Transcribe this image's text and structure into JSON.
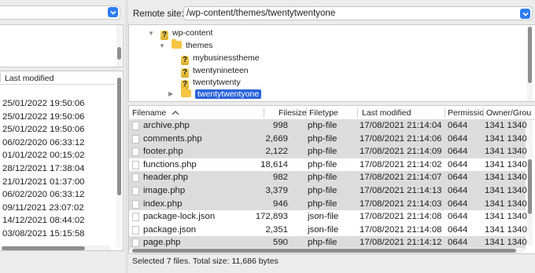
{
  "left_pane": {
    "last_modified_header": "Last modified",
    "dates": [
      "25/01/2022 19:50:06",
      "25/01/2022 19:50:06",
      "25/01/2022 19:50:06",
      "06/02/2020 06:33:12",
      "01/01/2022 00:15:02",
      "28/12/2021 17:38:04",
      "21/01/2021 01:37:00",
      "06/02/2020 06:33:12",
      "09/11/2021 23:07:02",
      "14/12/2021 08:44:02",
      "03/08/2021 15:15:58"
    ]
  },
  "remote": {
    "label": "Remote site:",
    "path": "/wp-content/themes/twentytwentyone",
    "tree": {
      "wp_content": "wp-content",
      "themes": "themes",
      "children": [
        "mybusinesstheme",
        "twentynineteen",
        "twentytwenty",
        "twentytwentyone"
      ]
    },
    "columns": {
      "filename": "Filename",
      "filesize": "Filesize",
      "filetype": "Filetype",
      "last_modified": "Last modified",
      "permissions": "Permissio",
      "owner_group": "Owner/Grou"
    },
    "files": [
      {
        "name": "archive.php",
        "size": "998",
        "type": "php-file",
        "modified": "17/08/2021 21:14:04",
        "perm": "0644",
        "owner": "1341 1340",
        "selected": true
      },
      {
        "name": "comments.php",
        "size": "2,669",
        "type": "php-file",
        "modified": "17/08/2021 21:14:06",
        "perm": "0644",
        "owner": "1341 1340",
        "selected": true
      },
      {
        "name": "footer.php",
        "size": "2,122",
        "type": "php-file",
        "modified": "17/08/2021 21:14:09",
        "perm": "0644",
        "owner": "1341 1340",
        "selected": true
      },
      {
        "name": "functions.php",
        "size": "18,614",
        "type": "php-file",
        "modified": "17/08/2021 21:14:02",
        "perm": "0644",
        "owner": "1341 1340",
        "selected": false
      },
      {
        "name": "header.php",
        "size": "982",
        "type": "php-file",
        "modified": "17/08/2021 21:14:07",
        "perm": "0644",
        "owner": "1341 1340",
        "selected": true
      },
      {
        "name": "image.php",
        "size": "3,379",
        "type": "php-file",
        "modified": "17/08/2021 21:14:13",
        "perm": "0644",
        "owner": "1341 1340",
        "selected": true
      },
      {
        "name": "index.php",
        "size": "946",
        "type": "php-file",
        "modified": "17/08/2021 21:14:03",
        "perm": "0644",
        "owner": "1341 1340",
        "selected": true
      },
      {
        "name": "package-lock.json",
        "size": "172,893",
        "type": "json-file",
        "modified": "17/08/2021 21:14:08",
        "perm": "0644",
        "owner": "1341 1340",
        "selected": false
      },
      {
        "name": "package.json",
        "size": "2,351",
        "type": "json-file",
        "modified": "17/08/2021 21:14:08",
        "perm": "0644",
        "owner": "1341 1340",
        "selected": false
      },
      {
        "name": "page.php",
        "size": "590",
        "type": "php-file",
        "modified": "17/08/2021 21:14:12",
        "perm": "0644",
        "owner": "1341 1340",
        "selected": true
      }
    ],
    "status": "Selected 7 files. Total size: 11,686 bytes"
  },
  "colors": {
    "accent": "#2a62d9",
    "selected_row": "#dcdcdc",
    "dropdown_button": "#2c7cf5"
  }
}
